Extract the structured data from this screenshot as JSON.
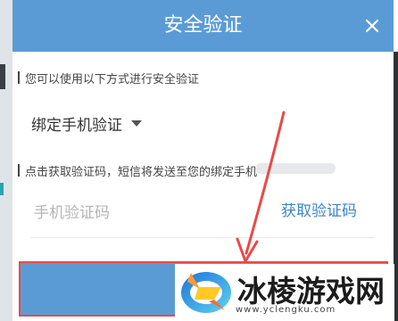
{
  "dialog": {
    "title": "安全验证",
    "intro_text": "您可以使用以下方式进行安全验证",
    "method": {
      "selected": "绑定手机验证"
    },
    "sms_hint": "点击获取验证码，短信将发送至您的绑定手机",
    "code_input": {
      "placeholder": "手机验证码",
      "value": ""
    },
    "get_code_label": "获取验证码"
  },
  "watermark": {
    "brand": "冰棱游戏网",
    "url": "www.yclengku.com"
  },
  "colors": {
    "header": "#5b9bd5",
    "link": "#3b86c9",
    "annotation": "#e84a4a"
  }
}
